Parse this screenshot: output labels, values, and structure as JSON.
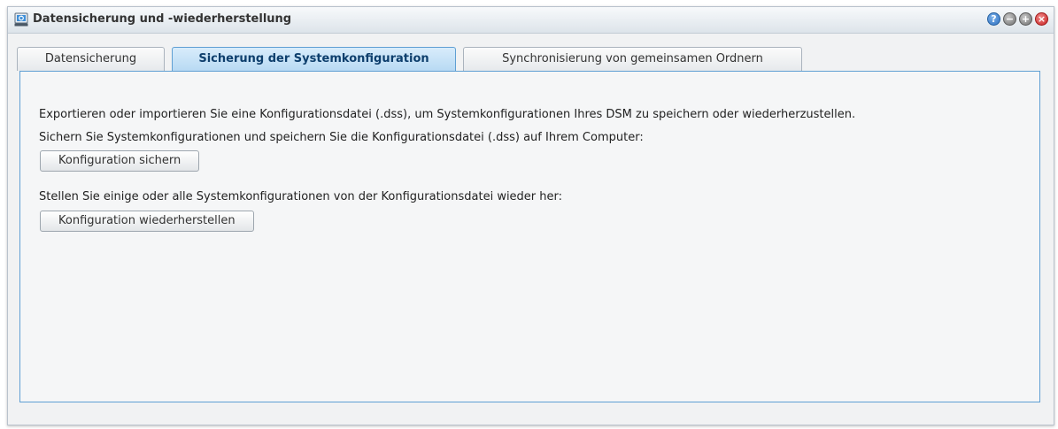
{
  "window": {
    "title": "Datensicherung und -wiederherstellung",
    "controls": {
      "help": "?",
      "minimize": "−",
      "maximize": "+",
      "close": "×"
    }
  },
  "tabs": [
    {
      "label": "Datensicherung",
      "active": false
    },
    {
      "label": "Sicherung der Systemkonfiguration",
      "active": true
    },
    {
      "label": "Synchronisierung von gemeinsamen Ordnern",
      "active": false
    }
  ],
  "content": {
    "intro": "Exportieren oder importieren Sie eine Konfigurationsdatei (.dss), um Systemkonfigurationen Ihres DSM zu speichern oder wiederherzustellen.",
    "backup_description": "Sichern Sie Systemkonfigurationen und speichern Sie die Konfigurationsdatei (.dss) auf Ihrem Computer:",
    "backup_button": "Konfiguration sichern",
    "restore_description": "Stellen Sie einige oder alle Systemkonfigurationen von der Konfigurationsdatei wieder her:",
    "restore_button": "Konfiguration wiederherstellen"
  },
  "icons": {
    "app": "backup-restore-icon",
    "help": "help-icon",
    "minimize": "minimize-icon",
    "maximize": "maximize-icon",
    "close": "close-icon"
  }
}
